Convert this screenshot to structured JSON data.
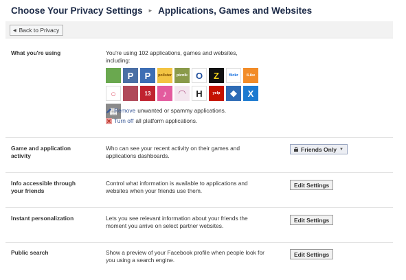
{
  "breadcrumb": {
    "parent": "Choose Your Privacy Settings",
    "separator": "▸",
    "current": "Applications, Games and Websites"
  },
  "toolbar": {
    "back_label": "Back to Privacy",
    "back_icon": "chevron-left-icon"
  },
  "sections": {
    "using": {
      "label": "What you're using",
      "description": "You're using 102 applications, games and websites, including:",
      "apps": [
        {
          "name": "globe-app-icon",
          "text": "",
          "bg": "#6aa84f",
          "fg": "#fff"
        },
        {
          "name": "p-app-icon",
          "text": "P",
          "bg": "#4a6fa5",
          "fg": "#fff"
        },
        {
          "name": "p-app-icon",
          "text": "P",
          "bg": "#3d6eb4",
          "fg": "#fff"
        },
        {
          "name": "polldaddy-app-icon",
          "text": "pollster",
          "bg": "#f3c443",
          "fg": "#7a4b00"
        },
        {
          "name": "picnik-app-icon",
          "text": "picnik",
          "bg": "#8a9a4a",
          "fg": "#fff"
        },
        {
          "name": "obama-app-icon",
          "text": "O",
          "bg": "#ffffff",
          "fg": "#1f4e9c"
        },
        {
          "name": "z-app-icon",
          "text": "Z",
          "bg": "#111111",
          "fg": "#f1d21a"
        },
        {
          "name": "flickr-app-icon",
          "text": "flickr",
          "bg": "#ffffff",
          "fg": "#0063dc"
        },
        {
          "name": "ilike-app-icon",
          "text": "iLike",
          "bg": "#f28c28",
          "fg": "#fff"
        },
        {
          "name": "ring-app-icon",
          "text": "○",
          "bg": "#ffffff",
          "fg": "#e05a6f"
        },
        {
          "name": "photo-app-icon",
          "text": "",
          "bg": "#b04a5a",
          "fg": "#fff"
        },
        {
          "name": "birthday-app-icon",
          "text": "13",
          "bg": "#c0232f",
          "fg": "#fff"
        },
        {
          "name": "music-app-icon",
          "text": "♪",
          "bg": "#e35b9e",
          "fg": "#fff"
        },
        {
          "name": "cake-app-icon",
          "text": "◠",
          "bg": "#f3e6ee",
          "fg": "#b35a8a"
        },
        {
          "name": "h-app-icon",
          "text": "H",
          "bg": "#ffffff",
          "fg": "#222222"
        },
        {
          "name": "yelp-app-icon",
          "text": "yelp",
          "bg": "#c41200",
          "fg": "#fff"
        },
        {
          "name": "trivia-app-icon",
          "text": "◆",
          "bg": "#2e6bb5",
          "fg": "#fff"
        },
        {
          "name": "scrabble-app-icon",
          "text": "X",
          "bg": "#1d7ad0",
          "fg": "#fff"
        },
        {
          "name": "game-app-icon",
          "text": "▦",
          "bg": "#8a8a8a",
          "fg": "#fff"
        }
      ],
      "remove": {
        "link": "Remove",
        "rest": "unwanted or spammy applications.",
        "icon": "pencil-icon",
        "icon_color": "#3b5998"
      },
      "turnoff": {
        "link": "Turn off",
        "rest": "all platform applications.",
        "icon": "x-icon",
        "icon_color": "#d9534f"
      }
    },
    "activity": {
      "label": "Game and application activity",
      "description": "Who can see your recent activity on their games and applications dashboards.",
      "setting": "Friends Only",
      "setting_icon": "lock-icon"
    },
    "info_friends": {
      "label": "Info accessible through your friends",
      "description": "Control what information is available to applications and websites when your friends use them.",
      "button": "Edit Settings"
    },
    "instant": {
      "label": "Instant personalization",
      "description": "Lets you see relevant information about your friends the moment you arrive on select partner websites.",
      "button": "Edit Settings"
    },
    "public_search": {
      "label": "Public search",
      "description": "Show a preview of your Facebook profile when people look for you using a search engine.",
      "button": "Edit Settings"
    }
  }
}
